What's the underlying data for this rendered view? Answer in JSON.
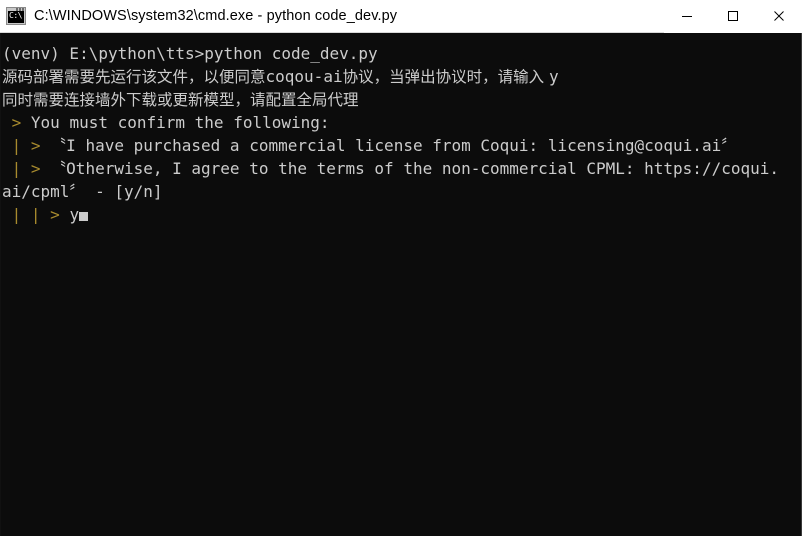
{
  "window": {
    "title": "C:\\WINDOWS\\system32\\cmd.exe - python  code_dev.py",
    "icon": "cmd-console-icon",
    "icon_glyph": "C:\\",
    "titlebar_bg": "#ffffff",
    "titlebar_fg": "#000000",
    "console_bg": "#0c0c0c",
    "console_fg": "#cccccc",
    "prompt_color": "#a88b2e",
    "controls": {
      "minimize_label": "Minimize",
      "maximize_label": "Maximize",
      "close_label": "Close"
    }
  },
  "console": {
    "lines": [
      {
        "id": "line-command",
        "segments": [
          {
            "text": "(venv) E:\\python\\tts>python code_dev.py",
            "style": "plain"
          }
        ]
      },
      {
        "id": "line-note-1",
        "segments": [
          {
            "text": "源码部署需要先运行该文件，以便同意",
            "style": "cjk"
          },
          {
            "text": "coqou-ai",
            "style": "plain"
          },
          {
            "text": "协议，当弹出协议时，请输入 ",
            "style": "cjk"
          },
          {
            "text": "y",
            "style": "plain"
          }
        ]
      },
      {
        "id": "line-note-2",
        "segments": [
          {
            "text": "同时需要连接墙外下载或更新模型，请配置全局代理",
            "style": "cjk"
          }
        ]
      },
      {
        "id": "line-confirm-header",
        "segments": [
          {
            "text": " > ",
            "style": "prompt"
          },
          {
            "text": "You must confirm the following:",
            "style": "plain"
          }
        ]
      },
      {
        "id": "line-confirm-1",
        "segments": [
          {
            "text": " | > ",
            "style": "prompt"
          },
          {
            "text": "〝I have purchased a commercial license from Coqui: licensing@coqui.ai〞",
            "style": "plain"
          }
        ]
      },
      {
        "id": "line-confirm-2",
        "segments": [
          {
            "text": " | > ",
            "style": "prompt"
          },
          {
            "text": "〝Otherwise, I agree to the terms of the non-commercial CPML: https://coqui.",
            "style": "plain"
          }
        ]
      },
      {
        "id": "line-confirm-2-wrap",
        "segments": [
          {
            "text": "ai/cpml〞 - [y/n]",
            "style": "plain"
          }
        ]
      },
      {
        "id": "line-input",
        "segments": [
          {
            "text": " | | > ",
            "style": "prompt"
          },
          {
            "text": "y",
            "style": "plain"
          }
        ],
        "cursor": true
      }
    ],
    "input_value": "y",
    "cursor_visible": true
  }
}
